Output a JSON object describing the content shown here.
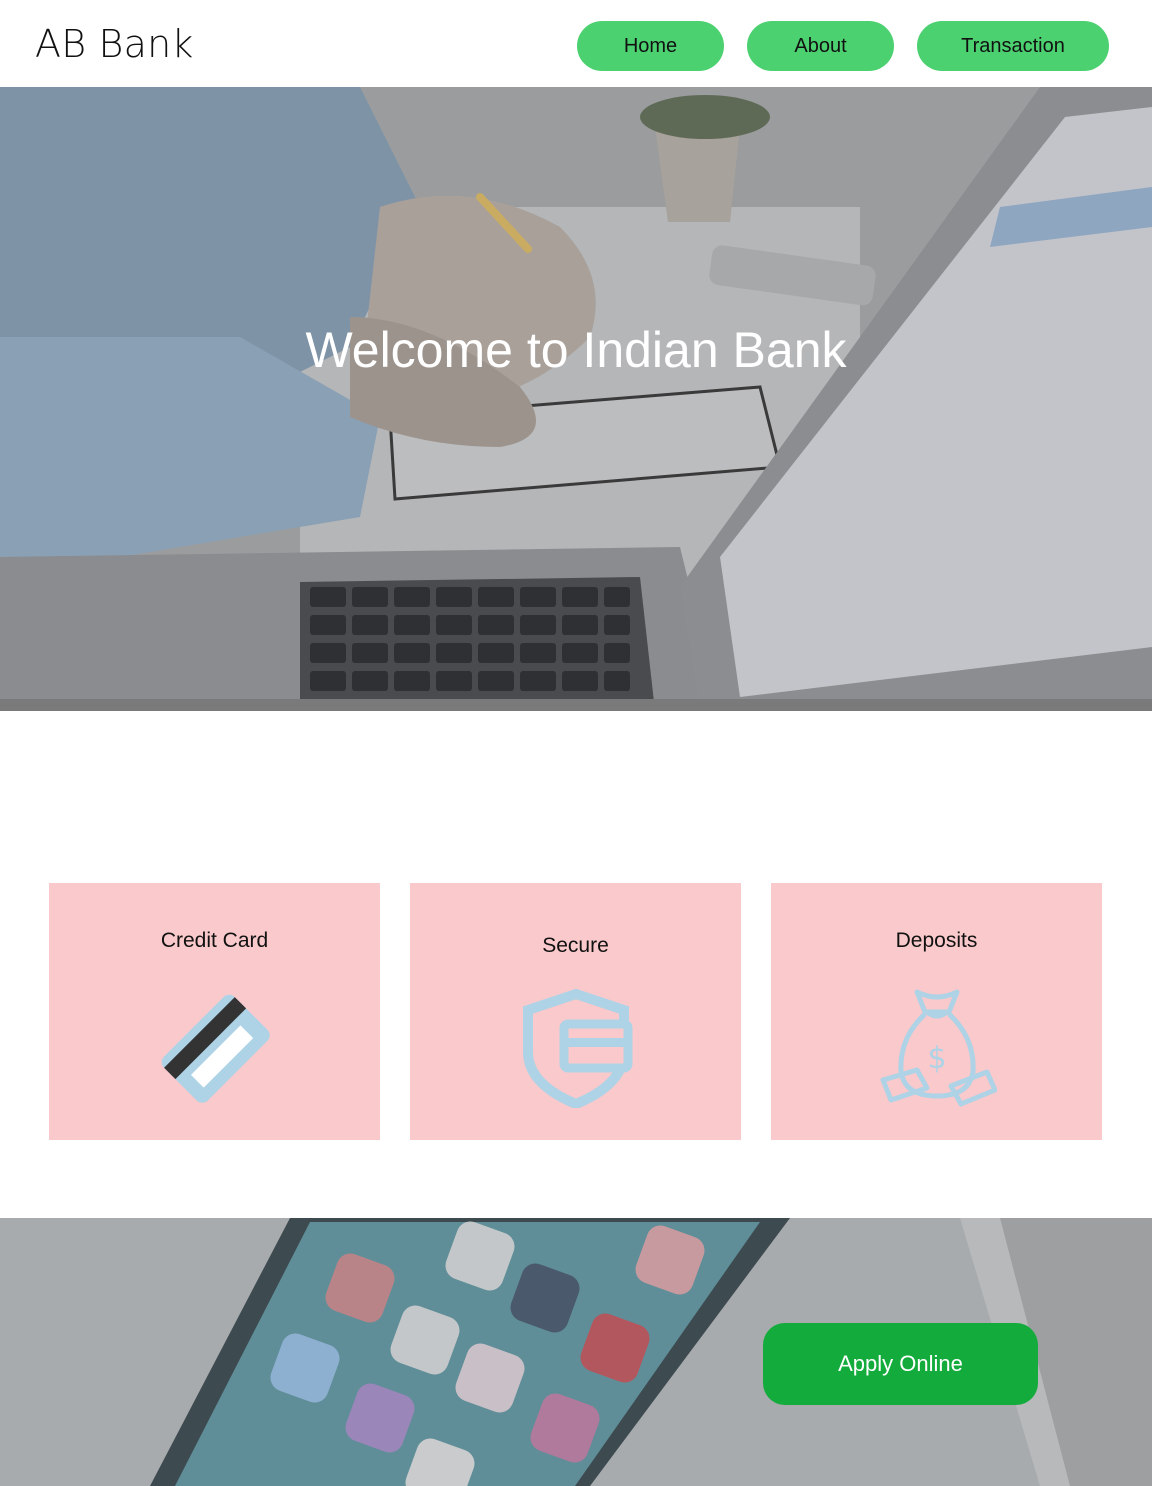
{
  "header": {
    "logo": "AB Bank",
    "nav": {
      "home": "Home",
      "about": "About",
      "transaction": "Transaction"
    }
  },
  "hero": {
    "title": "Welcome to Indian Bank"
  },
  "cards": [
    {
      "title": "Credit Card",
      "icon": "credit-card-icon"
    },
    {
      "title": "Secure",
      "icon": "secure-shield-icon"
    },
    {
      "title": "Deposits",
      "icon": "money-bag-icon"
    }
  ],
  "bottom": {
    "apply_label": "Apply Online"
  },
  "colors": {
    "nav_button": "#4cd171",
    "apply_button": "#13ab3c",
    "card_bg": "#f9c9cb",
    "icon_blue": "#aed3e6"
  }
}
